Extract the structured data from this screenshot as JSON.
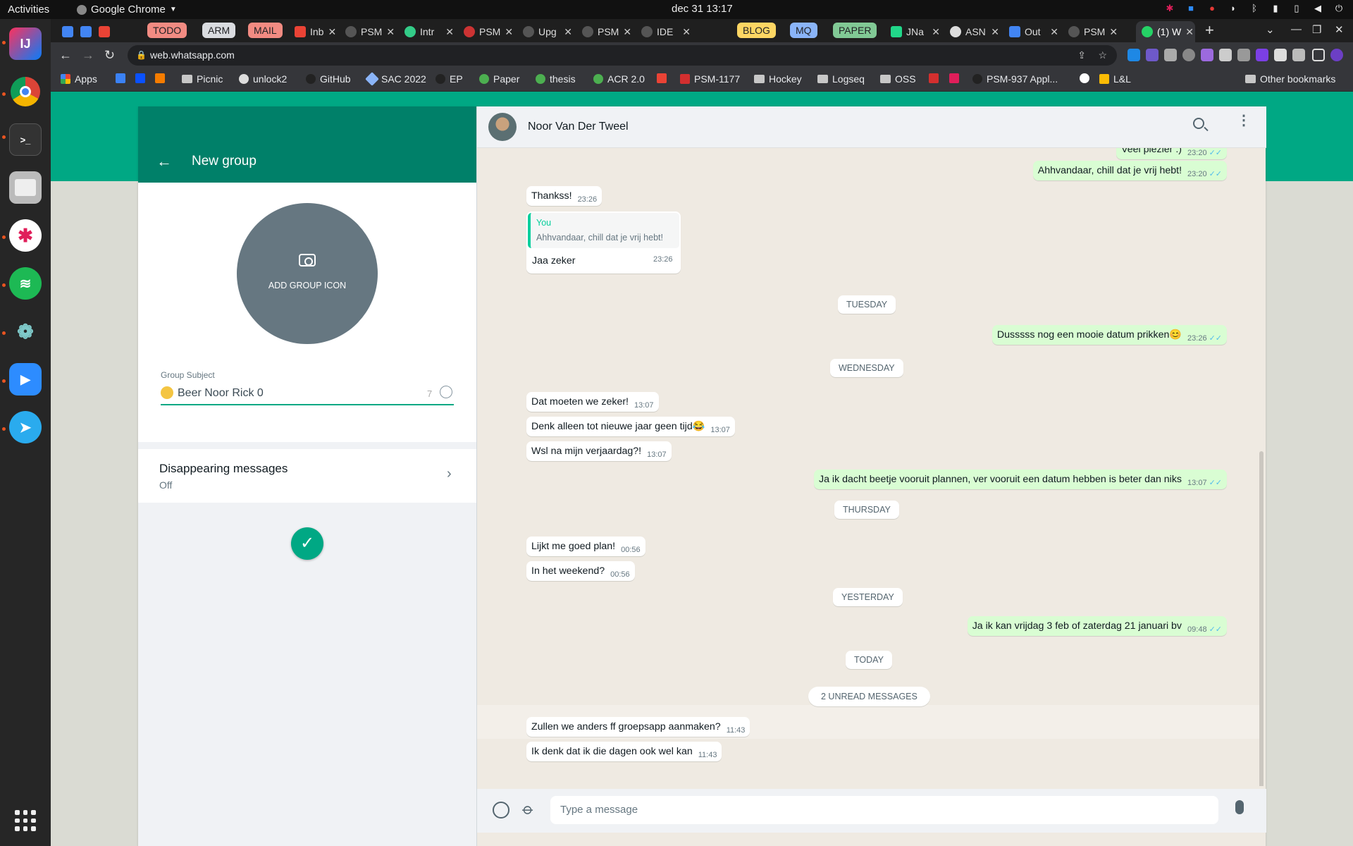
{
  "system": {
    "activities": "Activities",
    "app_name": "Google Chrome",
    "clock": "dec 31  13:17"
  },
  "tabs": [
    {
      "label": "TODO",
      "kind": "group",
      "color": "#f28b82"
    },
    {
      "label": "ARM",
      "kind": "group",
      "color": "#dadce0"
    },
    {
      "label": "MAIL",
      "kind": "group",
      "color": "#f28b82"
    },
    {
      "label": "Inb",
      "kind": "tab"
    },
    {
      "label": "PSM",
      "kind": "tab"
    },
    {
      "label": "Intr",
      "kind": "tab"
    },
    {
      "label": "PSM",
      "kind": "tab"
    },
    {
      "label": "Upg",
      "kind": "tab"
    },
    {
      "label": "PSM",
      "kind": "tab"
    },
    {
      "label": "IDE",
      "kind": "tab"
    },
    {
      "label": "BLOG",
      "kind": "group",
      "color": "#fdd663"
    },
    {
      "label": "MQ",
      "kind": "group",
      "color": "#8ab4f8"
    },
    {
      "label": "PAPER",
      "kind": "group",
      "color": "#81c995"
    },
    {
      "label": "JNa",
      "kind": "tab"
    },
    {
      "label": "ASN",
      "kind": "tab"
    },
    {
      "label": "Out",
      "kind": "tab"
    },
    {
      "label": "PSM",
      "kind": "tab"
    },
    {
      "label": "(1) W",
      "kind": "active"
    }
  ],
  "omnibox": {
    "url": "web.whatsapp.com"
  },
  "bookmarks": [
    "Apps",
    "",
    "",
    "",
    "Picnic",
    "unlock2",
    "GitHub",
    "SAC 2022",
    "EP",
    "Paper",
    "thesis",
    "ACR 2.0",
    "",
    "PSM-1177",
    "Hockey",
    "Logseq",
    "OSS",
    "",
    "",
    "PSM-937 Appl...",
    "",
    "L&L"
  ],
  "other_bookmarks": "Other bookmarks",
  "new_group": {
    "title": "New group",
    "add_icon_label": "ADD GROUP ICON",
    "subject_label": "Group Subject",
    "subject_value": "Beer Noor Rick 0",
    "char_count": "7",
    "disappearing_title": "Disappearing messages",
    "disappearing_value": "Off"
  },
  "chat": {
    "contact_name": "Noor Van Der Tweel",
    "composer_placeholder": "Type a message",
    "messages": [
      {
        "dir": "out",
        "text": "Veel plezier :)",
        "time": "23:20"
      },
      {
        "dir": "out",
        "text": "Ahhvandaar, chill dat je vrij hebt!",
        "time": "23:20"
      },
      {
        "dir": "in",
        "text": "Thankss!",
        "time": "23:26"
      },
      {
        "dir": "in",
        "text": "Jaa zeker",
        "time": "23:26",
        "quote_author": "You",
        "quote_text": "Ahhvandaar, chill dat je vrij hebt!"
      },
      {
        "dir": "sys",
        "text": "TUESDAY"
      },
      {
        "dir": "out",
        "text": "Dusssss nog een mooie datum prikken😊",
        "time": "23:26"
      },
      {
        "dir": "sys",
        "text": "WEDNESDAY"
      },
      {
        "dir": "in",
        "text": "Dat moeten we zeker!",
        "time": "13:07"
      },
      {
        "dir": "in",
        "text": "Denk alleen tot nieuwe jaar geen tijd😂",
        "time": "13:07"
      },
      {
        "dir": "in",
        "text": "Wsl na mijn verjaardag?!",
        "time": "13:07"
      },
      {
        "dir": "out",
        "text": "Ja ik dacht beetje vooruit plannen, ver vooruit een datum hebben is beter dan niks",
        "time": "13:07"
      },
      {
        "dir": "sys",
        "text": "THURSDAY"
      },
      {
        "dir": "in",
        "text": "Lijkt me goed plan!",
        "time": "00:56"
      },
      {
        "dir": "in",
        "text": "In het weekend?",
        "time": "00:56"
      },
      {
        "dir": "sys",
        "text": "YESTERDAY"
      },
      {
        "dir": "out",
        "text": "Ja ik kan vrijdag 3 feb of zaterdag 21 januari bv",
        "time": "09:48"
      },
      {
        "dir": "sys",
        "text": "TODAY"
      },
      {
        "dir": "sys",
        "text": "2 UNREAD MESSAGES"
      },
      {
        "dir": "in",
        "text": "Zullen we anders ff groepsapp aanmaken?",
        "time": "11:43"
      },
      {
        "dir": "in",
        "text": "Ik denk dat ik die dagen ook wel kan",
        "time": "11:43"
      }
    ]
  },
  "colors": {
    "whatsapp_green": "#00a884",
    "header_green": "#008069",
    "outgoing_bubble": "#d9fdd3",
    "read_ticks": "#53bdeb"
  }
}
